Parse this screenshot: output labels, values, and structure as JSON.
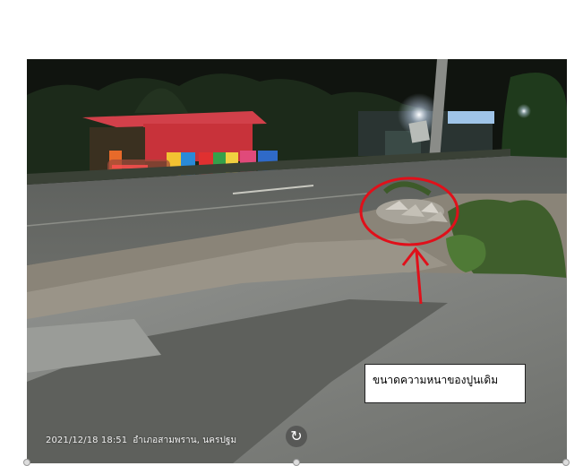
{
  "photo": {
    "callout_text": "ขนาดความหนาของปูนเดิม",
    "timestamp": "2021/12/18 18:51",
    "location": "อำเภอสามพราน, นครปฐม",
    "rotate_icon": "↻"
  },
  "colors": {
    "annotation_red": "#e0101a",
    "shop_red": "#c8323a"
  }
}
